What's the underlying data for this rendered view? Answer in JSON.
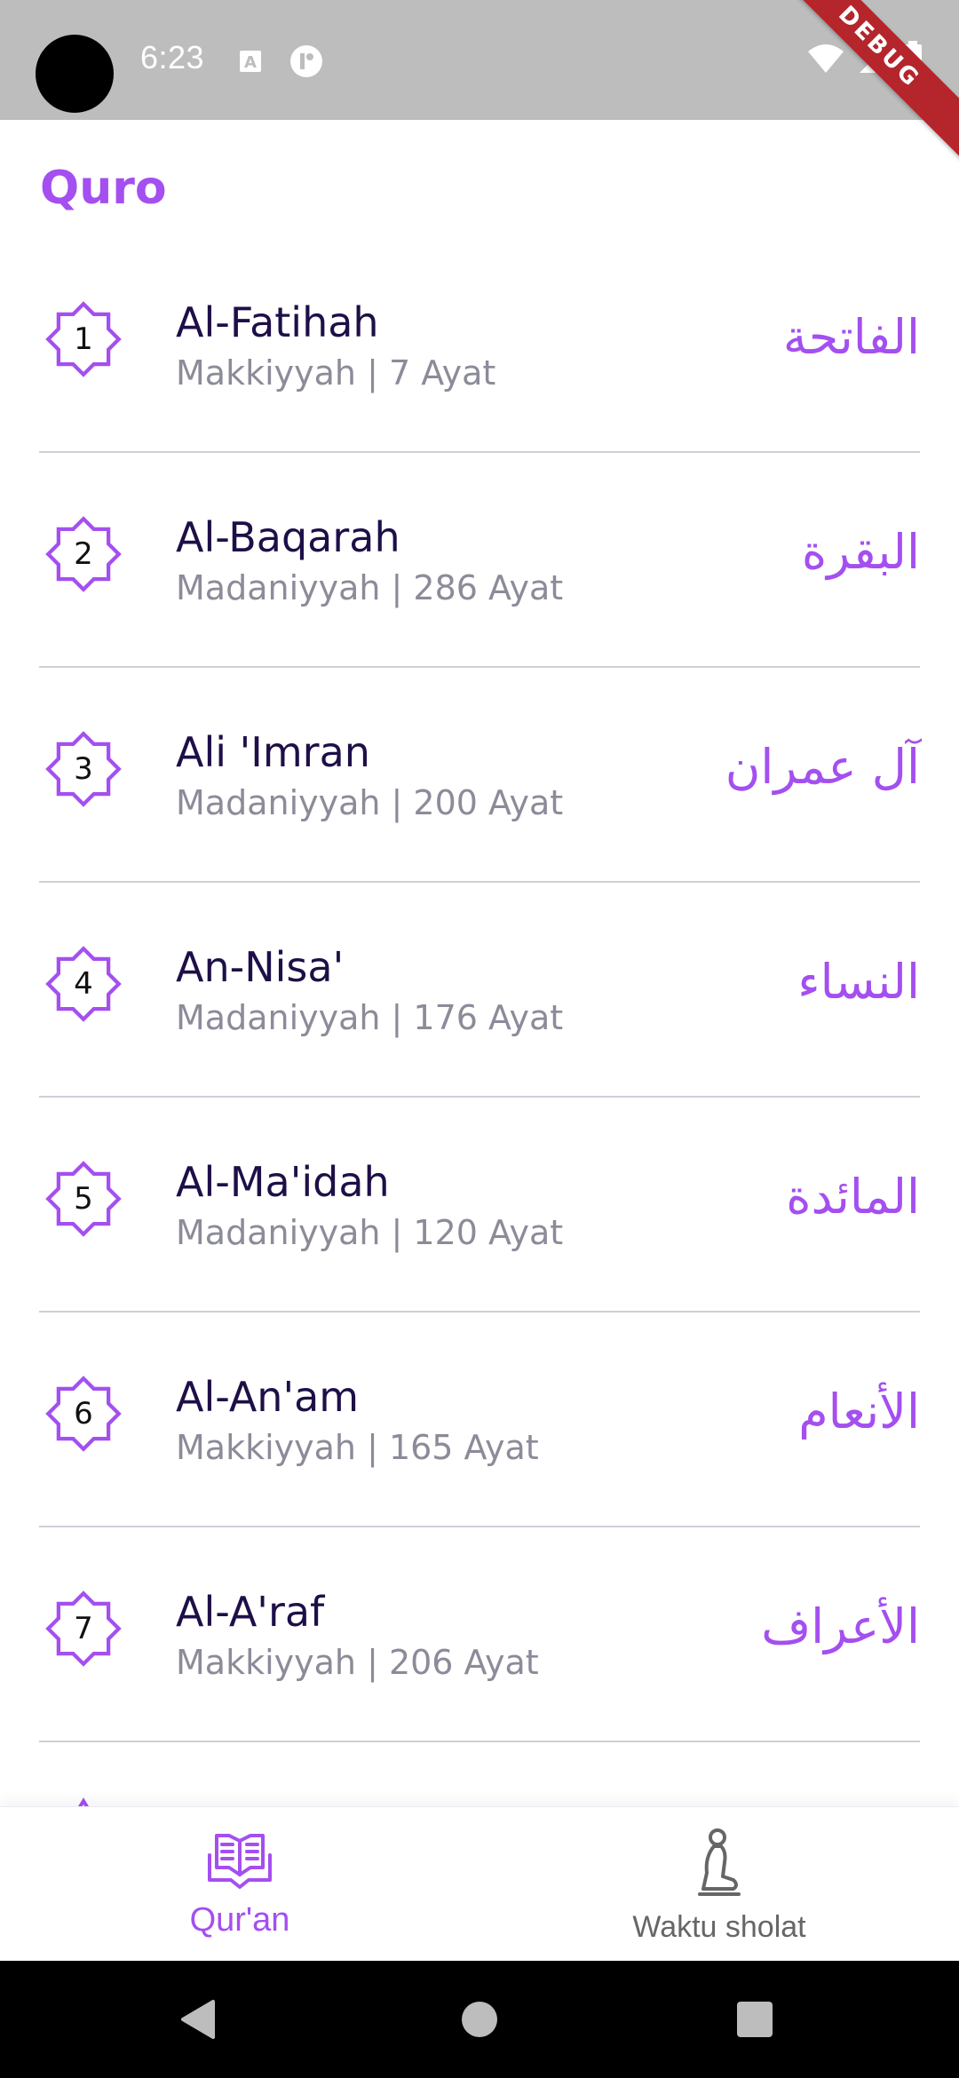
{
  "status_bar": {
    "time": "6:23",
    "icons_left": [
      "keyboard-a-icon",
      "app-notification-icon"
    ],
    "icons_right": [
      "wifi-icon",
      "signal-icon",
      "battery-icon"
    ]
  },
  "debug_banner": "DEBUG",
  "app": {
    "title": "Quro"
  },
  "surahs": [
    {
      "number": "1",
      "name": "Al-Fatihah",
      "info": "Makkiyyah | 7 Ayat",
      "arabic": "الفاتحة"
    },
    {
      "number": "2",
      "name": "Al-Baqarah",
      "info": "Madaniyyah | 286 Ayat",
      "arabic": "البقرة"
    },
    {
      "number": "3",
      "name": "Ali 'Imran",
      "info": "Madaniyyah | 200 Ayat",
      "arabic": "آل عمران"
    },
    {
      "number": "4",
      "name": "An-Nisa'",
      "info": "Madaniyyah | 176 Ayat",
      "arabic": "النساء"
    },
    {
      "number": "5",
      "name": "Al-Ma'idah",
      "info": "Madaniyyah | 120 Ayat",
      "arabic": "المائدة"
    },
    {
      "number": "6",
      "name": "Al-An'am",
      "info": "Makkiyyah | 165 Ayat",
      "arabic": "الأنعام"
    },
    {
      "number": "7",
      "name": "Al-A'raf",
      "info": "Makkiyyah | 206 Ayat",
      "arabic": "الأعراف"
    }
  ],
  "bottom_nav": {
    "tabs": [
      {
        "label": "Qur'an",
        "icon": "quran-book-icon",
        "active": true
      },
      {
        "label": "Waktu sholat",
        "icon": "praying-person-icon",
        "active": false
      }
    ]
  },
  "colors": {
    "accent": "#a44ff0",
    "title_text": "#1e0f48",
    "subtitle_text": "#8b8b99",
    "status_bar": "#bdbdbd",
    "debug_ribbon": "#b4262c"
  }
}
